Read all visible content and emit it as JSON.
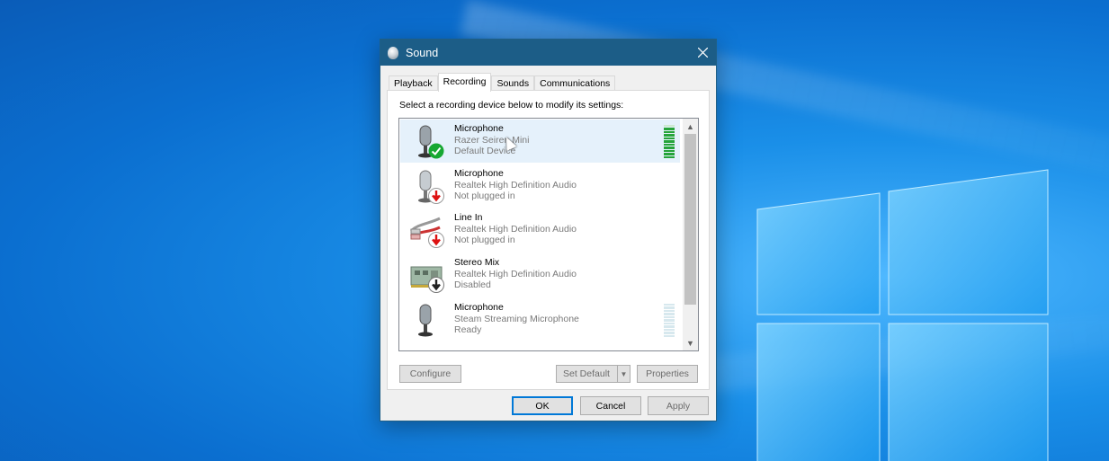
{
  "window": {
    "title": "Sound"
  },
  "tabs": [
    {
      "label": "Playback"
    },
    {
      "label": "Recording"
    },
    {
      "label": "Sounds"
    },
    {
      "label": "Communications"
    }
  ],
  "active_tab": "Recording",
  "instruction": "Select a recording device below to modify its settings:",
  "devices": [
    {
      "name": "Microphone",
      "description": "Razer Seiren Mini",
      "state": "Default Device",
      "icon": "microphone-icon",
      "badge": "default-check-icon",
      "selected": true,
      "level": 0.95
    },
    {
      "name": "Microphone",
      "description": "Realtek High Definition Audio",
      "state": "Not plugged in",
      "icon": "microphone-icon",
      "badge": "unplugged-arrow-icon"
    },
    {
      "name": "Line In",
      "description": "Realtek High Definition Audio",
      "state": "Not plugged in",
      "icon": "line-in-cable-icon",
      "badge": "unplugged-arrow-icon"
    },
    {
      "name": "Stereo Mix",
      "description": "Realtek High Definition Audio",
      "state": "Disabled",
      "icon": "sound-card-icon",
      "badge": "disabled-arrow-icon"
    },
    {
      "name": "Microphone",
      "description": "Steam Streaming Microphone",
      "state": "Ready",
      "icon": "microphone-icon",
      "level": 0.0
    }
  ],
  "buttons": {
    "configure": "Configure",
    "set_default": "Set Default",
    "properties": "Properties",
    "ok": "OK",
    "cancel": "Cancel",
    "apply": "Apply"
  },
  "colors": {
    "titlebar": "#1c5d87",
    "selection": "#e5f1fb",
    "meter_active": "#26a43a",
    "focus_border": "#0078d7"
  }
}
